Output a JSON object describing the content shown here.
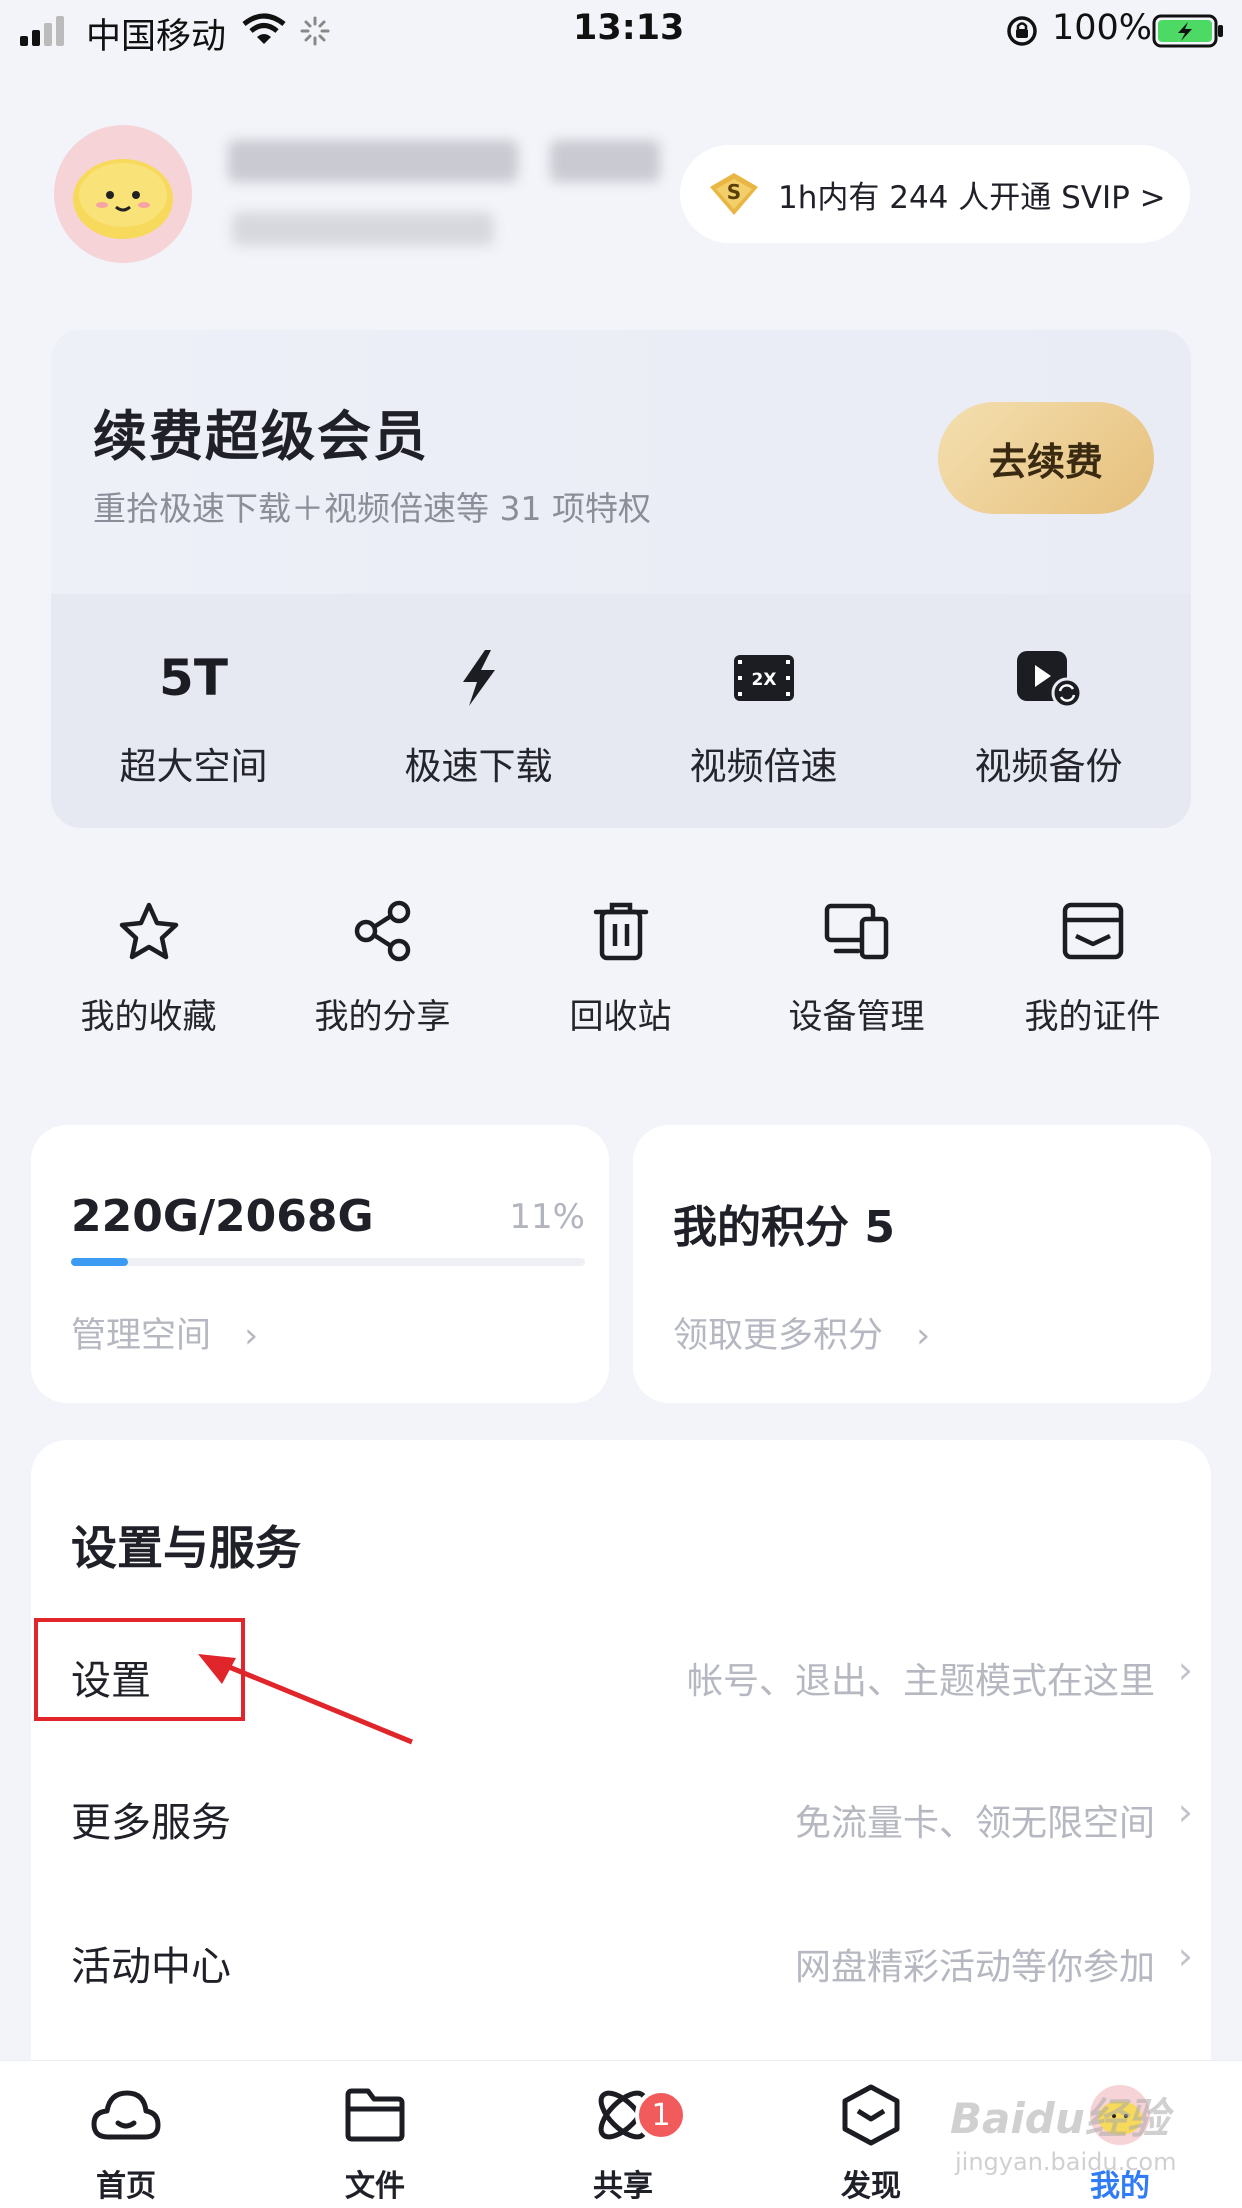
{
  "status_bar": {
    "carrier": "中国移动",
    "time": "13:13",
    "battery": "100%"
  },
  "profile": {
    "svip_banner": "1h内有 244 人开通 SVIP >"
  },
  "renew": {
    "title": "续费超级会员",
    "subtitle": "重拾极速下载＋视频倍速等 31 项特权",
    "button": "去续费",
    "perks": [
      {
        "icon": "5T",
        "label": "超大空间"
      },
      {
        "icon": "lightning-icon",
        "label": "极速下载"
      },
      {
        "icon": "2X",
        "label": "视频倍速"
      },
      {
        "icon": "video-backup-icon",
        "label": "视频备份"
      }
    ]
  },
  "shortcuts": [
    {
      "icon": "star-icon",
      "label": "我的收藏"
    },
    {
      "icon": "share-icon",
      "label": "我的分享"
    },
    {
      "icon": "trash-icon",
      "label": "回收站"
    },
    {
      "icon": "devices-icon",
      "label": "设备管理"
    },
    {
      "icon": "id-card-icon",
      "label": "我的证件"
    }
  ],
  "storage": {
    "used": "220G/2068G",
    "percent_text": "11%",
    "percent": 11,
    "link": "管理空间"
  },
  "points": {
    "title": "我的积分 5",
    "link": "领取更多积分"
  },
  "settings_section": {
    "title": "设置与服务",
    "rows": [
      {
        "label": "设置",
        "hint": "帐号、退出、主题模式在这里"
      },
      {
        "label": "更多服务",
        "hint": "免流量卡、领无限空间"
      },
      {
        "label": "活动中心",
        "hint": "网盘精彩活动等你参加"
      }
    ]
  },
  "tabs": [
    {
      "label": "首页",
      "icon": "cloud-icon"
    },
    {
      "label": "文件",
      "icon": "folder-icon"
    },
    {
      "label": "共享",
      "icon": "orbit-icon",
      "badge": "1"
    },
    {
      "label": "发现",
      "icon": "cube-icon"
    },
    {
      "label": "我的",
      "icon": "avatar-icon",
      "active": true
    }
  ],
  "watermark": {
    "text": "Baidu经验",
    "sub": "jingyan.baidu.com"
  },
  "colors": {
    "accent": "#2f7cf6",
    "annotation": "#e0262b",
    "progress": "#3b9bf3",
    "badge": "#f25b5b"
  }
}
